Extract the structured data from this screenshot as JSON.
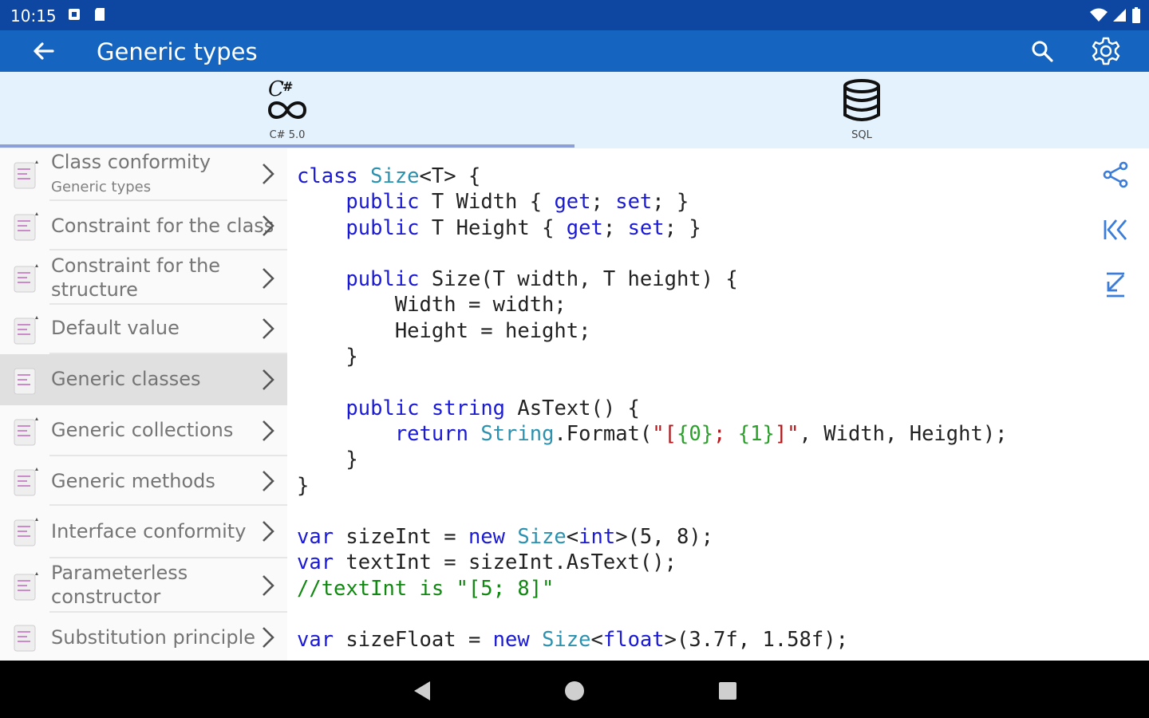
{
  "status_bar": {
    "time": "10:15"
  },
  "app_bar": {
    "title": "Generic types"
  },
  "tabs": [
    {
      "label": "C# 5.0",
      "selected": true
    },
    {
      "label": "SQL",
      "selected": false
    }
  ],
  "sidebar": {
    "items": [
      {
        "label": "Class conformity",
        "sublabel": "Generic types",
        "selected": false
      },
      {
        "label": "Constraint for the class",
        "selected": false
      },
      {
        "label_line1": "Constraint for the",
        "label_line2": "structure",
        "selected": false
      },
      {
        "label": "Default value",
        "selected": false
      },
      {
        "label": "Generic classes",
        "selected": true
      },
      {
        "label": "Generic collections",
        "selected": false
      },
      {
        "label": "Generic methods",
        "selected": false
      },
      {
        "label": "Interface conformity",
        "selected": false
      },
      {
        "label_line1": "Parameterless",
        "label_line2": "constructor",
        "selected": false
      },
      {
        "label": "Substitution principle",
        "selected": false
      }
    ]
  },
  "code": {
    "line1": [
      "class",
      "Size",
      "<T> {"
    ],
    "line2": [
      "public",
      "T Width {",
      "get",
      ";",
      "set",
      "; }"
    ],
    "line3": [
      "public",
      "T Height {",
      "get",
      ";",
      "set",
      "; }"
    ],
    "line5": [
      "public",
      "Size(T width, T height) {"
    ],
    "line6": "Width = width;",
    "line7": "Height = height;",
    "line8": "}",
    "line10": [
      "public",
      "string",
      "AsText() {"
    ],
    "line11": [
      "return",
      "String",
      ".Format(",
      "\"[",
      "{0}",
      ";",
      "{1}",
      "]\"",
      ", Width, Height);"
    ],
    "line12": "}",
    "line13": "}",
    "line15": [
      "var",
      "sizeInt =",
      "new",
      "Size",
      "<",
      "int",
      ">(5, 8);"
    ],
    "line16": [
      "var",
      "textInt = sizeInt.AsText();"
    ],
    "line17": "//textInt is \"[5; 8]\"",
    "line19": [
      "var",
      "sizeFloat =",
      "new",
      "Size",
      "<",
      "float",
      ">(3.7f, 1.58f);"
    ]
  },
  "colors": {
    "status_bar": "#0d47a1",
    "app_bar": "#1565c0",
    "tabs_bg": "#e3f2fd",
    "keyword": "#1a1ad6",
    "type": "#2b91af",
    "string": "#b3171b",
    "comment": "#118811"
  }
}
